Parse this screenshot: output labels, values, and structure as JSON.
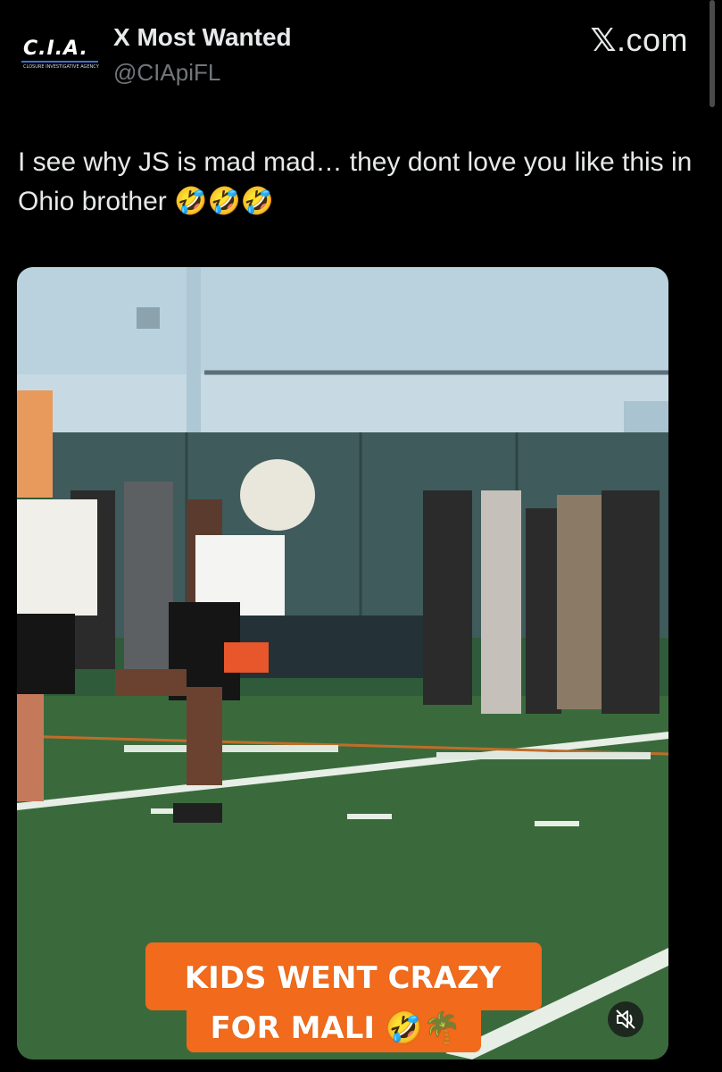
{
  "author": {
    "avatar_text": "C.I.A.",
    "avatar_subtext": "CLOSURE INVESTIGATIVE AGENCY",
    "display_name": "X Most Wanted",
    "handle": "@CIApiFL"
  },
  "brand": {
    "x_glyph": "𝕏",
    "label": ".com"
  },
  "tweet": {
    "text": "I see why JS is mad mad… they dont love you like this in Ohio brother 🤣🤣🤣"
  },
  "media": {
    "type": "video",
    "caption_line1": "KIDS WENT CRAZY",
    "caption_line2": "FOR MALI 🤣🌴",
    "mute_icon": "muted-speaker-icon",
    "caption_color": "#f26a1b"
  },
  "colors": {
    "background": "#000000",
    "text": "#e7e9ea",
    "secondary_text": "#71767b"
  }
}
